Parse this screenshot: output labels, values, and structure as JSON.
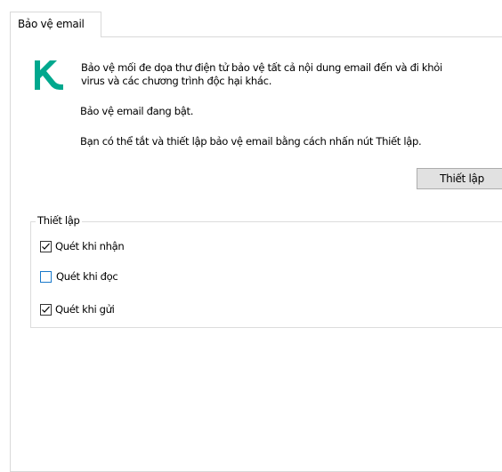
{
  "tab": {
    "label": "Bảo vệ email"
  },
  "brand": {
    "logo_icon": "kaspersky-k-logo-icon",
    "color": "#00a88e"
  },
  "info": {
    "line1": "Bảo vệ mối đe dọa thư điện tử bảo vệ tất cả nội dung email đến và đi khỏi",
    "line2": "virus và các chương trình độc hại khác.",
    "status": "Bảo vệ email đang bật.",
    "hint": "Bạn có thể tắt và thiết lập bảo vệ email bằng cách nhấn nút Thiết lập."
  },
  "settings_button": {
    "label": "Thiết lập"
  },
  "settings_group": {
    "title": "Thiết lập",
    "options": [
      {
        "label": "Quét khi nhận",
        "checked": true
      },
      {
        "label": "Quét khi đọc",
        "checked": false
      },
      {
        "label": "Quét khi gửi",
        "checked": true
      }
    ]
  }
}
